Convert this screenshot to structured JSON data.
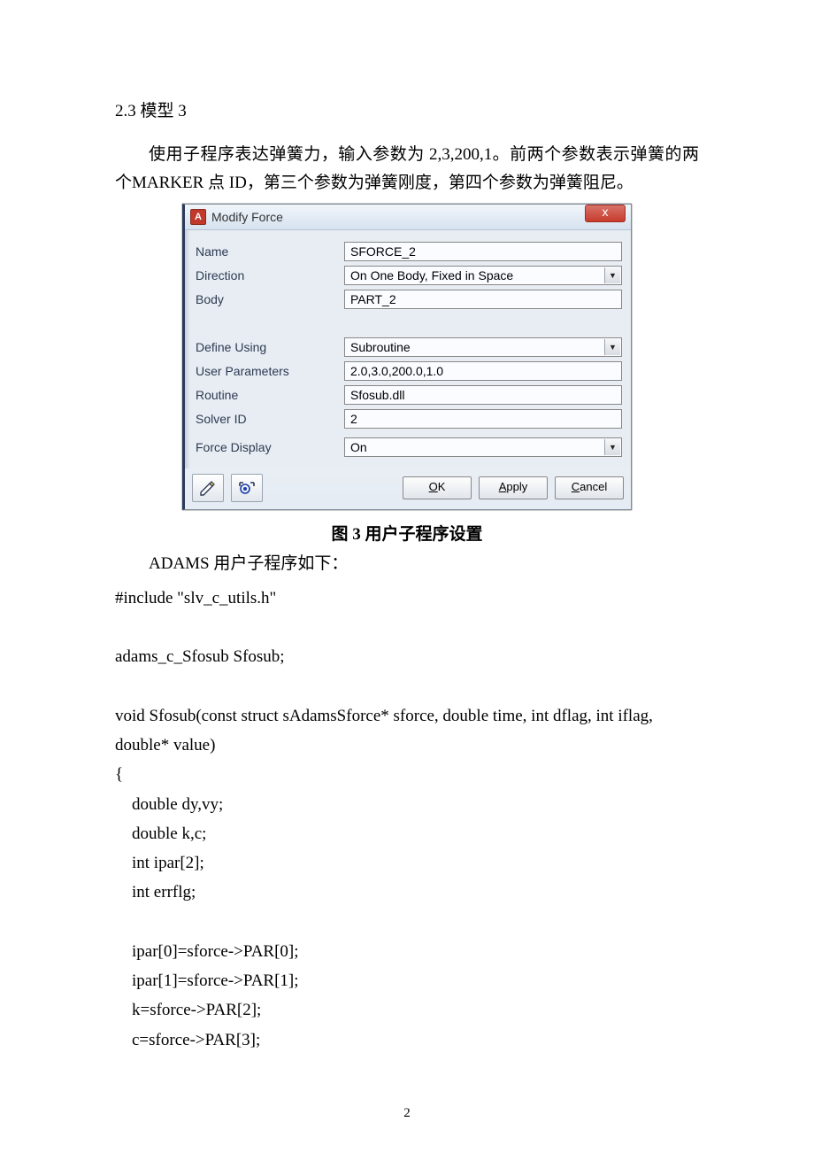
{
  "doc": {
    "section_heading": "2.3 模型 3",
    "para1": "使用子程序表达弹簧力，输入参数为 2,3,200,1。前两个参数表示弹簧的两个MARKER 点 ID，第三个参数为弹簧刚度，第四个参数为弹簧阻尼。",
    "figure_caption": "图 3  用户子程序设置",
    "para2_indent": "ADAMS 用户子程序如下：",
    "code_lines": [
      "#include \"slv_c_utils.h\"",
      "",
      "adams_c_Sfosub Sfosub;",
      "",
      "void Sfosub(const struct sAdamsSforce* sforce, double time, int dflag, int iflag, double* value)",
      "{",
      "    double dy,vy;",
      "    double k,c;",
      "    int ipar[2];",
      "    int errflg;",
      "",
      "    ipar[0]=sforce->PAR[0];",
      "    ipar[1]=sforce->PAR[1];",
      "    k=sforce->PAR[2];",
      "    c=sforce->PAR[3];"
    ],
    "page_number": "2"
  },
  "dialog": {
    "title": "Modify Force",
    "close_label": "x",
    "labels": {
      "name": "Name",
      "direction": "Direction",
      "body": "Body",
      "define_using": "Define Using",
      "user_parameters": "User Parameters",
      "routine": "Routine",
      "solver_id": "Solver ID",
      "force_display": "Force Display"
    },
    "values": {
      "name": "SFORCE_2",
      "direction": "On One Body, Fixed in Space",
      "body": "PART_2",
      "define_using": "Subroutine",
      "user_parameters": "2.0,3.0,200.0,1.0",
      "routine": "Sfosub.dll",
      "solver_id": "2",
      "force_display": "On"
    },
    "buttons": {
      "ok": "OK",
      "apply": "Apply",
      "cancel": "Cancel"
    }
  }
}
